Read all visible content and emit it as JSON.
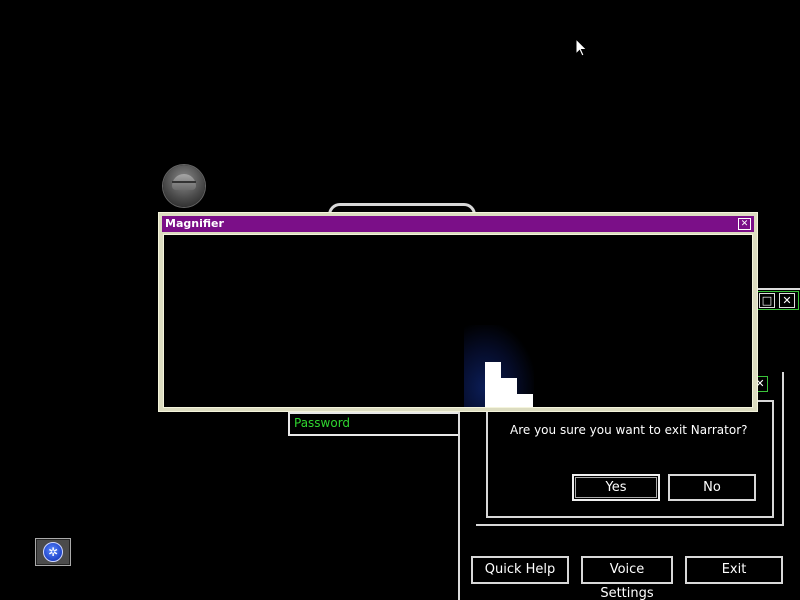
{
  "magnifier": {
    "title": "Magnifier",
    "close_glyph": "✕"
  },
  "login": {
    "password_placeholder": "Password"
  },
  "narrator": {
    "maximize_glyph": "□",
    "close_glyph": "✕",
    "buttons": {
      "quick_help": "Quick Help",
      "voice_settings": "Voice Settings",
      "exit": "Exit"
    }
  },
  "confirm_dialog": {
    "message": "Are you sure you want to exit Narrator?",
    "close_glyph": "✕",
    "yes_label": "Yes",
    "no_label": "No"
  },
  "icons": {
    "ease_of_access": "ease-of-access-icon",
    "avatar": "user-avatar-icon",
    "cursor": "mouse-pointer-icon"
  },
  "colors": {
    "magnifier_title_bar": "#7b0f88",
    "password_placeholder": "#2fd52f",
    "narrator_accent": "#3ac43a"
  }
}
